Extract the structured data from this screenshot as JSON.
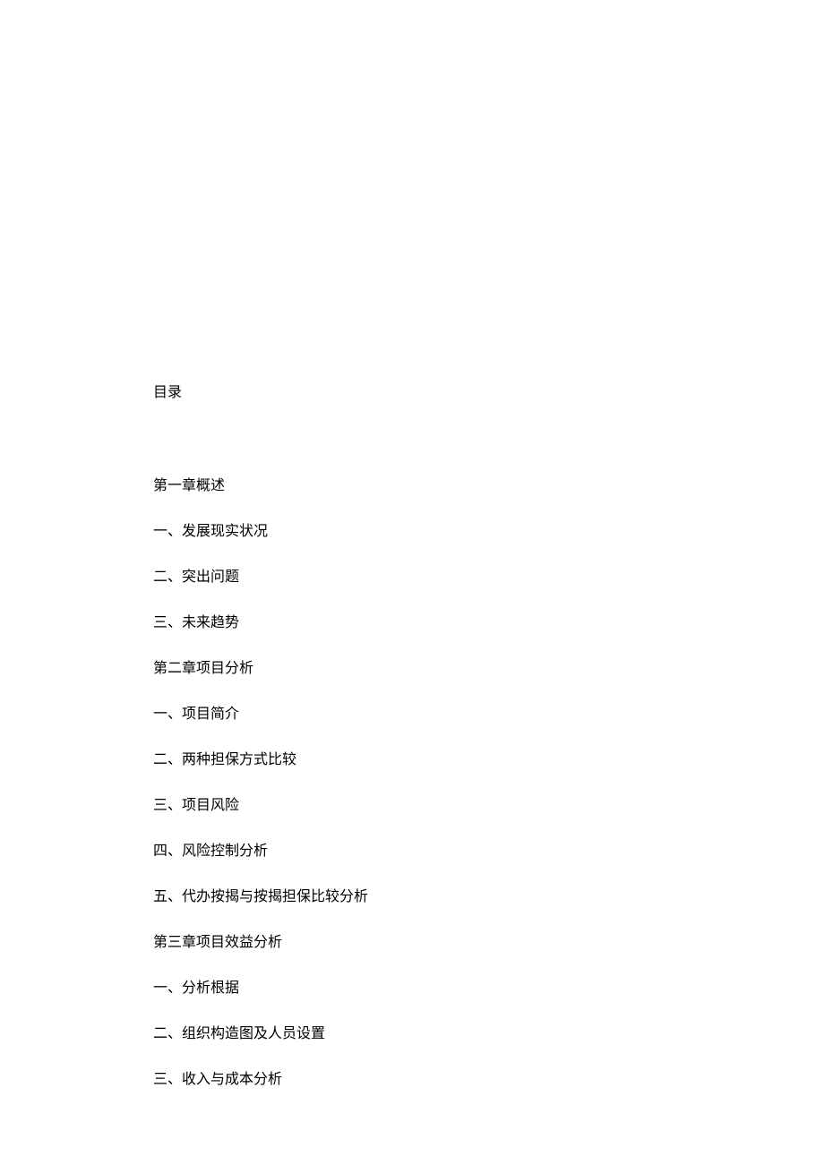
{
  "toc": {
    "title": "目录",
    "lines": [
      "第一章概述",
      "一、发展现实状况",
      "二、突出问题",
      "三、未来趋势",
      "第二章项目分析",
      "一、项目简介",
      "二、两种担保方式比较",
      "三、项目风险",
      "四、风险控制分析",
      "五、代办按揭与按揭担保比较分析",
      "第三章项目效益分析",
      "一、分析根据",
      "二、组织构造图及人员设置",
      "三、收入与成本分析"
    ]
  }
}
